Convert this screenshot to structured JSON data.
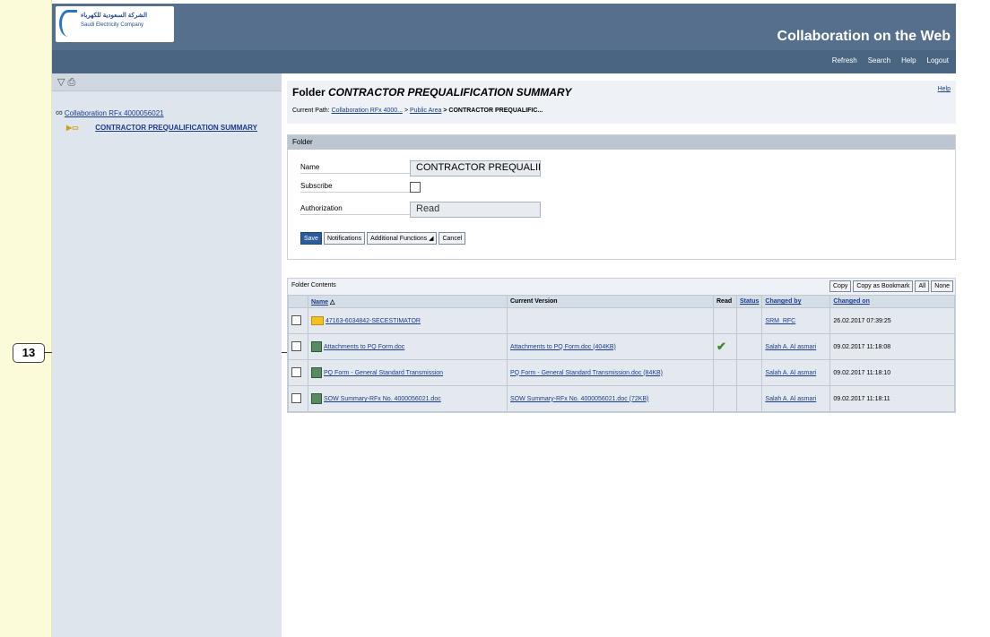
{
  "callout": {
    "number": "13"
  },
  "header": {
    "logo_arabic": "الشركة السعودية للكهرباء",
    "logo_english": "Saudi Electricity Company",
    "app_title": "Collaboration on the Web"
  },
  "topnav": {
    "links": [
      "Refresh",
      "Search",
      "Help",
      "Logout"
    ]
  },
  "sidebar": {
    "tools": "▽ ⎙",
    "tree_root": "Collaboration RFx 4000056021",
    "tree_child": "CONTRACTOR PREQUALIFICATION SUMMARY"
  },
  "page": {
    "title_prefix": "Folder ",
    "title_italic": "CONTRACTOR PREQUALIFICATION SUMMARY",
    "help": "Help",
    "path_label": "Current Path:",
    "path_link1": "Collaboration RFx 4000...",
    "path_sep": ">",
    "path_link2": "Public Area",
    "path_current": "> CONTRACTOR PREQUALIFIC..."
  },
  "folder": {
    "header": "Folder",
    "name_label": "Name",
    "name_value": "CONTRACTOR PREQUALIFICATION SUMMARY",
    "subscribe_label": "Subscribe",
    "authorization_label": "Authorization",
    "authorization_value": "Read",
    "buttons": {
      "save": "Save",
      "notifications": "Notifications",
      "additional": "Additional Functions ◢",
      "cancel": "Cancel"
    }
  },
  "contents": {
    "header": "Folder Contents",
    "actions": [
      "Copy",
      "Copy as Bookmark",
      "All",
      "None"
    ],
    "columns": [
      "Name",
      "Current Version",
      "Read",
      "Status",
      "Changed by",
      "Changed on"
    ],
    "rows": [
      {
        "name": "47163-6034842-SECESTIMATOR",
        "type": "folder",
        "version": "",
        "read": "",
        "status": "",
        "changed_by": "SRM_RFC",
        "changed_on": "26.02.2017 07:39:25"
      },
      {
        "name": "Attachments to PQ Form.doc",
        "type": "doc",
        "version": "Attachments to PQ Form.doc (404KB)",
        "read": "✔",
        "status": "",
        "changed_by": "Salah A. Al asmari",
        "changed_on": "09.02.2017 11:18:08"
      },
      {
        "name": "PQ Form - General Standard Transmission",
        "type": "doc",
        "version": "PQ Form - General Standard Transmission.doc (84KB)",
        "read": "",
        "status": "",
        "changed_by": "Salah A. Al asmari",
        "changed_on": "09.02.2017 11:18:10"
      },
      {
        "name": "SOW Summary-RFx No. 4000056021.doc",
        "type": "doc",
        "version": "SOW Summary-RFx No. 4000056021.doc (72KB)",
        "read": "",
        "status": "",
        "changed_by": "Salah A. Al asmari",
        "changed_on": "09.02.2017 11:18:11"
      }
    ]
  }
}
